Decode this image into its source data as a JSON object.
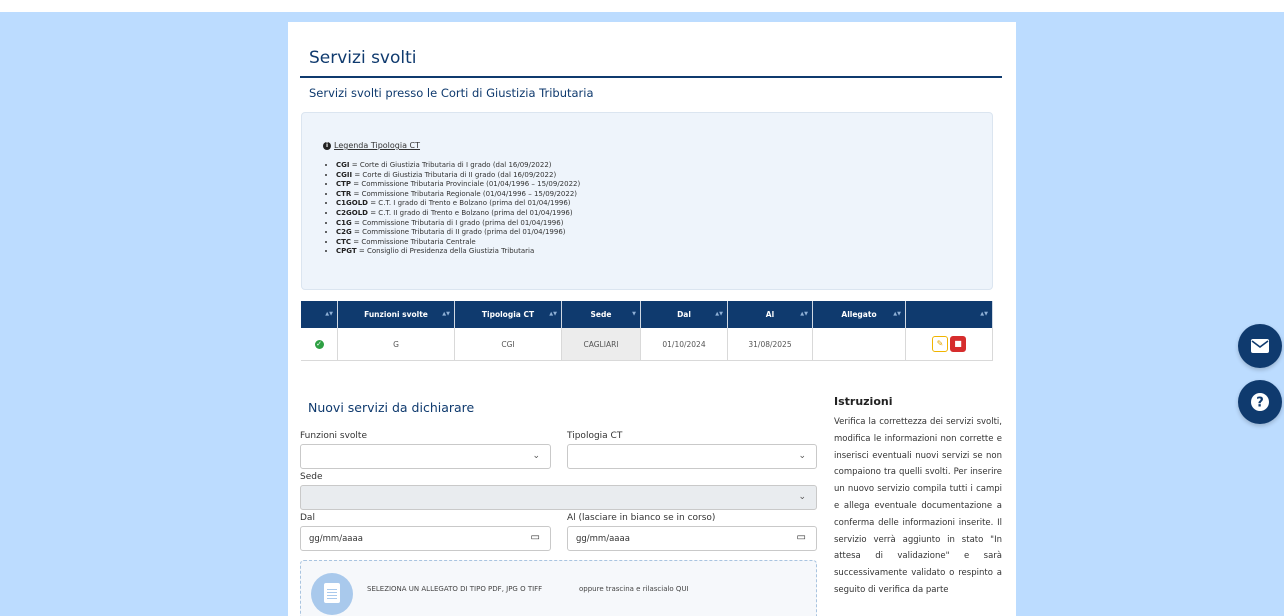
{
  "page_title": "Servizi svolti",
  "subtitle": "Servizi svolti presso le Corti di Giustizia Tributaria",
  "legend": {
    "title": "Legenda Tipologia CT",
    "items": [
      {
        "code": "CGI",
        "desc": " = Corte di Giustizia Tributaria di I grado (dal 16/09/2022)"
      },
      {
        "code": "CGII",
        "desc": " = Corte di Giustizia Tributaria di II grado (dal 16/09/2022)"
      },
      {
        "code": "CTP",
        "desc": " = Commissione Tributaria Provinciale (01/04/1996 – 15/09/2022)"
      },
      {
        "code": "CTR",
        "desc": " = Commissione Tributaria Regionale (01/04/1996 – 15/09/2022)"
      },
      {
        "code": "C1GOLD",
        "desc": " = C.T. I grado di Trento e Bolzano (prima del 01/04/1996)"
      },
      {
        "code": "C2GOLD",
        "desc": " = C.T. II grado di Trento e Bolzano (prima del 01/04/1996)"
      },
      {
        "code": "C1G",
        "desc": " = Commissione Tributaria di I grado (prima del 01/04/1996)"
      },
      {
        "code": "C2G",
        "desc": " = Commissione Tributaria di II grado (prima del 01/04/1996)"
      },
      {
        "code": "CTC",
        "desc": " = Commissione Tributaria Centrale"
      },
      {
        "code": "CPGT",
        "desc": " = Consiglio di Presidenza della Giustizia Tributaria"
      }
    ]
  },
  "table": {
    "headers": [
      "",
      "Funzioni svolte",
      "Tipologia CT",
      "Sede",
      "Dal",
      "Al",
      "Allegato",
      ""
    ],
    "rows": [
      {
        "funzioni": "G",
        "tipologia": "CGI",
        "sede": "CAGLIARI",
        "dal": "01/10/2024",
        "al": "31/08/2025",
        "allegato": ""
      }
    ]
  },
  "form": {
    "title": "Nuovi servizi da dichiarare",
    "funzioni_label": "Funzioni svolte",
    "tipologia_label": "Tipologia CT",
    "sede_label": "Sede",
    "dal_label": "Dal",
    "al_label": "Al (lasciare in bianco se in corso)",
    "date_placeholder": "gg/mm/aaaa",
    "upload_button": "SELEZIONA UN ALLEGATO DI TIPO PDF, JPG O TIFF",
    "upload_hint": "oppure trascina e rilascialo QUI"
  },
  "instructions": {
    "title": "Istruzioni",
    "text": "Verifica la correttezza dei servizi svolti, modifica le informazioni non corrette e inserisci eventuali nuovi servizi se non compaiono tra quelli svolti. Per inserire un nuovo servizio compila tutti i campi e allega eventuale documentazione a conferma delle informazioni inserite. Il servizio verrà aggiunto in stato \"In attesa di validazione\" e sarà successivamente validato o respinto a seguito di verifica da parte"
  },
  "icons": {
    "status": "check-circle-icon",
    "edit": "edit-icon",
    "delete": "trash-icon",
    "mail": "envelope-icon",
    "help": "question-icon"
  },
  "colors": {
    "primary": "#0f3a6e",
    "background": "#bcdcff",
    "ok": "#2ea043",
    "danger": "#d62d2d",
    "warning": "#f0b400"
  }
}
